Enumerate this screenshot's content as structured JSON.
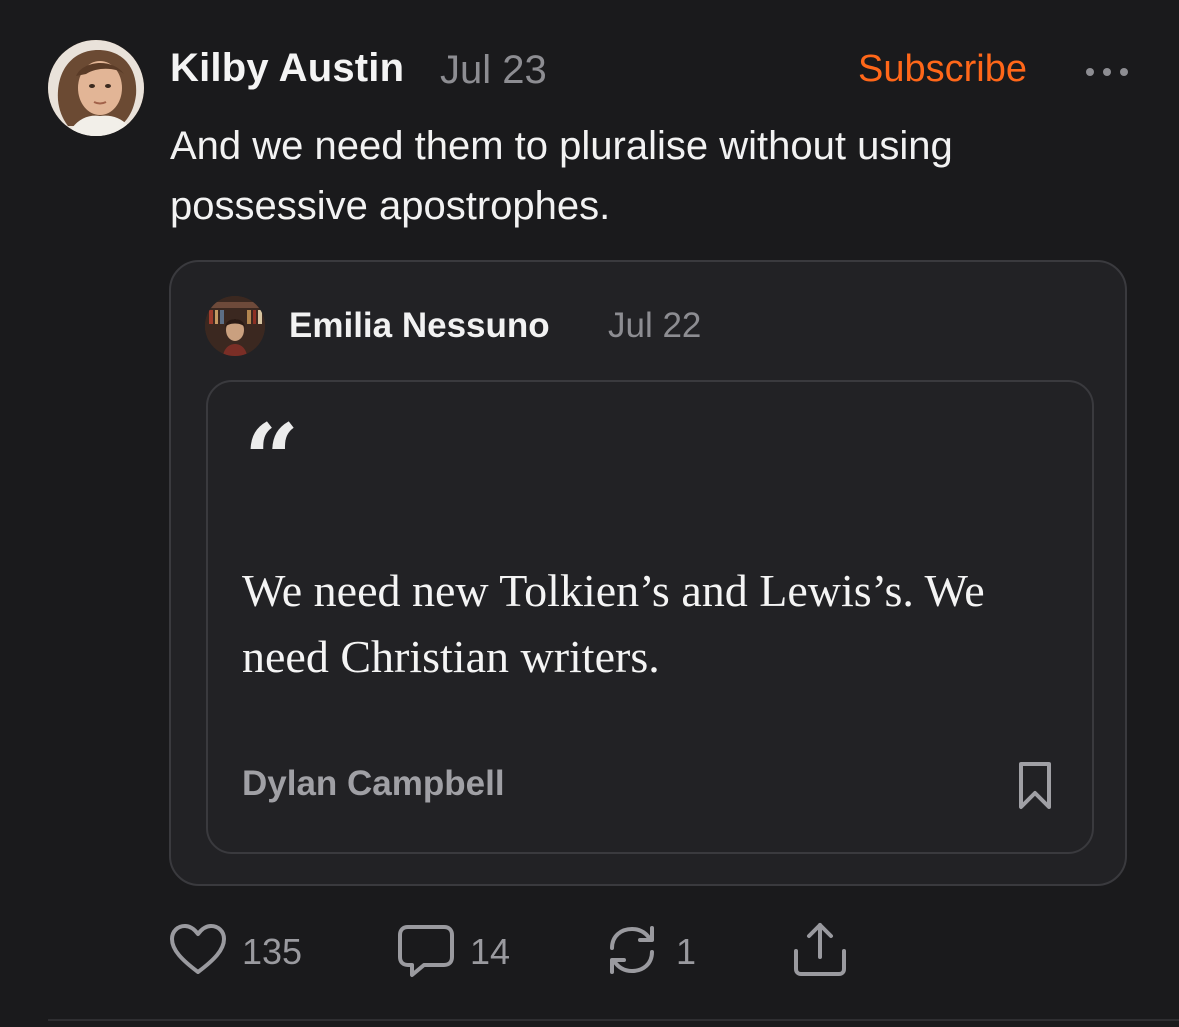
{
  "post": {
    "author": "Kilby Austin",
    "date": "Jul 23",
    "subscribe_label": "Subscribe",
    "body": "And we need them to pluralise without using possessive apostrophes."
  },
  "quoted": {
    "author": "Emilia Nessuno",
    "date": "Jul 22",
    "quote_mark": "“",
    "quote_text": "We need new Tolkien’s and Lewis’s. We need Christian writers.",
    "quote_source": "Dylan Campbell"
  },
  "actions": {
    "likes": "135",
    "comments": "14",
    "restacks": "1"
  },
  "icons": {
    "like": "heart-icon",
    "comment": "comment-icon",
    "restack": "restack-icon",
    "share": "share-icon",
    "more": "more-icon",
    "bookmark": "bookmark-icon"
  },
  "colors": {
    "accent": "#ff6719",
    "background": "#1a1a1c",
    "card": "#222225",
    "muted": "#8d8d92"
  }
}
